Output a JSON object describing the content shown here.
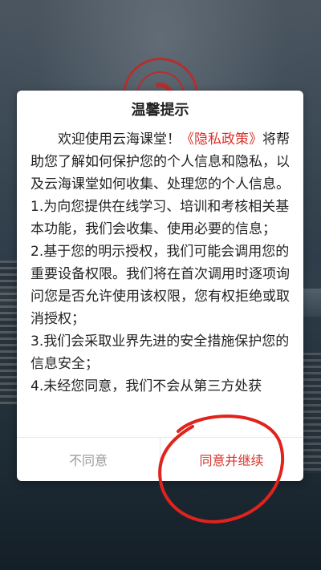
{
  "dialog": {
    "title": "温馨提示",
    "intro_prefix": "欢迎使用云海课堂！",
    "policy_link": "《隐私政策》",
    "intro_suffix": "将帮助您了解如何保护您的个人信息和隐私，以及云海课堂如何收集、处理您的个人信息。",
    "items": [
      "1.为向您提供在线学习、培训和考核相关基本功能，我们会收集、使用必要的信息；",
      "2.基于您的明示授权，我们可能会调用您的重要设备权限。我们将在首次调用时逐项询问您是否允许使用该权限，您有权拒绝或取消授权；",
      "3.我们会采取业界先进的安全措施保护您的信息安全；",
      "4.未经您同意，我们不会从第三方处获"
    ],
    "disagree_label": "不同意",
    "agree_label": "同意并继续"
  },
  "colors": {
    "accent": "#d9322b",
    "muted": "#9a9a9a",
    "annotation": "#e0231c"
  },
  "icons": {
    "background_logo": "yunhai-logo-icon"
  }
}
